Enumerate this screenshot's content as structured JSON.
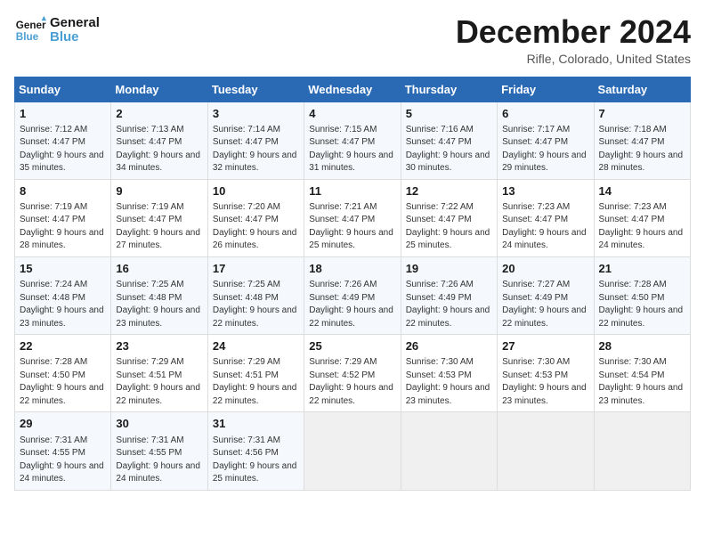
{
  "logo": {
    "text_general": "General",
    "text_blue": "Blue"
  },
  "title": "December 2024",
  "subtitle": "Rifle, Colorado, United States",
  "weekdays": [
    "Sunday",
    "Monday",
    "Tuesday",
    "Wednesday",
    "Thursday",
    "Friday",
    "Saturday"
  ],
  "weeks": [
    [
      {
        "day": "1",
        "sunrise": "7:12 AM",
        "sunset": "4:47 PM",
        "daylight": "9 hours and 35 minutes."
      },
      {
        "day": "2",
        "sunrise": "7:13 AM",
        "sunset": "4:47 PM",
        "daylight": "9 hours and 34 minutes."
      },
      {
        "day": "3",
        "sunrise": "7:14 AM",
        "sunset": "4:47 PM",
        "daylight": "9 hours and 32 minutes."
      },
      {
        "day": "4",
        "sunrise": "7:15 AM",
        "sunset": "4:47 PM",
        "daylight": "9 hours and 31 minutes."
      },
      {
        "day": "5",
        "sunrise": "7:16 AM",
        "sunset": "4:47 PM",
        "daylight": "9 hours and 30 minutes."
      },
      {
        "day": "6",
        "sunrise": "7:17 AM",
        "sunset": "4:47 PM",
        "daylight": "9 hours and 29 minutes."
      },
      {
        "day": "7",
        "sunrise": "7:18 AM",
        "sunset": "4:47 PM",
        "daylight": "9 hours and 28 minutes."
      }
    ],
    [
      {
        "day": "8",
        "sunrise": "7:19 AM",
        "sunset": "4:47 PM",
        "daylight": "9 hours and 28 minutes."
      },
      {
        "day": "9",
        "sunrise": "7:19 AM",
        "sunset": "4:47 PM",
        "daylight": "9 hours and 27 minutes."
      },
      {
        "day": "10",
        "sunrise": "7:20 AM",
        "sunset": "4:47 PM",
        "daylight": "9 hours and 26 minutes."
      },
      {
        "day": "11",
        "sunrise": "7:21 AM",
        "sunset": "4:47 PM",
        "daylight": "9 hours and 25 minutes."
      },
      {
        "day": "12",
        "sunrise": "7:22 AM",
        "sunset": "4:47 PM",
        "daylight": "9 hours and 25 minutes."
      },
      {
        "day": "13",
        "sunrise": "7:23 AM",
        "sunset": "4:47 PM",
        "daylight": "9 hours and 24 minutes."
      },
      {
        "day": "14",
        "sunrise": "7:23 AM",
        "sunset": "4:47 PM",
        "daylight": "9 hours and 24 minutes."
      }
    ],
    [
      {
        "day": "15",
        "sunrise": "7:24 AM",
        "sunset": "4:48 PM",
        "daylight": "9 hours and 23 minutes."
      },
      {
        "day": "16",
        "sunrise": "7:25 AM",
        "sunset": "4:48 PM",
        "daylight": "9 hours and 23 minutes."
      },
      {
        "day": "17",
        "sunrise": "7:25 AM",
        "sunset": "4:48 PM",
        "daylight": "9 hours and 22 minutes."
      },
      {
        "day": "18",
        "sunrise": "7:26 AM",
        "sunset": "4:49 PM",
        "daylight": "9 hours and 22 minutes."
      },
      {
        "day": "19",
        "sunrise": "7:26 AM",
        "sunset": "4:49 PM",
        "daylight": "9 hours and 22 minutes."
      },
      {
        "day": "20",
        "sunrise": "7:27 AM",
        "sunset": "4:49 PM",
        "daylight": "9 hours and 22 minutes."
      },
      {
        "day": "21",
        "sunrise": "7:28 AM",
        "sunset": "4:50 PM",
        "daylight": "9 hours and 22 minutes."
      }
    ],
    [
      {
        "day": "22",
        "sunrise": "7:28 AM",
        "sunset": "4:50 PM",
        "daylight": "9 hours and 22 minutes."
      },
      {
        "day": "23",
        "sunrise": "7:29 AM",
        "sunset": "4:51 PM",
        "daylight": "9 hours and 22 minutes."
      },
      {
        "day": "24",
        "sunrise": "7:29 AM",
        "sunset": "4:51 PM",
        "daylight": "9 hours and 22 minutes."
      },
      {
        "day": "25",
        "sunrise": "7:29 AM",
        "sunset": "4:52 PM",
        "daylight": "9 hours and 22 minutes."
      },
      {
        "day": "26",
        "sunrise": "7:30 AM",
        "sunset": "4:53 PM",
        "daylight": "9 hours and 23 minutes."
      },
      {
        "day": "27",
        "sunrise": "7:30 AM",
        "sunset": "4:53 PM",
        "daylight": "9 hours and 23 minutes."
      },
      {
        "day": "28",
        "sunrise": "7:30 AM",
        "sunset": "4:54 PM",
        "daylight": "9 hours and 23 minutes."
      }
    ],
    [
      {
        "day": "29",
        "sunrise": "7:31 AM",
        "sunset": "4:55 PM",
        "daylight": "9 hours and 24 minutes."
      },
      {
        "day": "30",
        "sunrise": "7:31 AM",
        "sunset": "4:55 PM",
        "daylight": "9 hours and 24 minutes."
      },
      {
        "day": "31",
        "sunrise": "7:31 AM",
        "sunset": "4:56 PM",
        "daylight": "9 hours and 25 minutes."
      },
      null,
      null,
      null,
      null
    ]
  ]
}
